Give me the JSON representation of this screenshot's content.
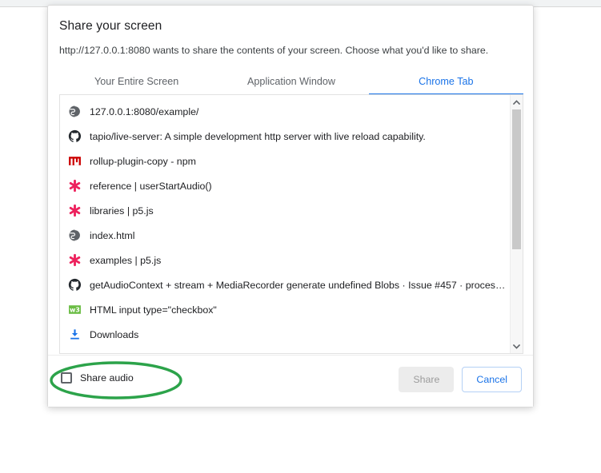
{
  "dialog": {
    "title": "Share your screen",
    "description": "http://127.0.0.1:8080 wants to share the contents of your screen. Choose what you'd like to share.",
    "tabs": [
      {
        "label": "Your Entire Screen",
        "active": false
      },
      {
        "label": "Application Window",
        "active": false
      },
      {
        "label": "Chrome Tab",
        "active": true
      }
    ],
    "list": [
      {
        "icon": "globe-icon",
        "label": "127.0.0.1:8080/example/"
      },
      {
        "icon": "github-icon",
        "label": "tapio/live-server: A simple development http server with live reload capability."
      },
      {
        "icon": "npm-icon",
        "label": "rollup-plugin-copy - npm"
      },
      {
        "icon": "p5js-icon",
        "label": "reference | userStartAudio()"
      },
      {
        "icon": "p5js-icon",
        "label": "libraries | p5.js"
      },
      {
        "icon": "globe-icon",
        "label": "index.html"
      },
      {
        "icon": "p5js-icon",
        "label": "examples | p5.js"
      },
      {
        "icon": "github-icon",
        "label": "getAudioContext + stream + MediaRecorder generate undefined Blobs · Issue #457 · processing..."
      },
      {
        "icon": "w3schools-icon",
        "label": "HTML input type=\"checkbox\""
      },
      {
        "icon": "download-icon",
        "label": "Downloads"
      }
    ],
    "scrollbar": {
      "up_arrow": "▲",
      "down_arrow": "▼"
    },
    "footer": {
      "share_audio_label": "Share audio",
      "share_audio_checked": false,
      "share_button": "Share",
      "share_button_disabled": true,
      "cancel_button": "Cancel"
    }
  },
  "annotation": {
    "shape": "ellipse",
    "color": "#2ca34a",
    "target": "share-audio-checkbox"
  },
  "colors": {
    "accent": "#1a73e8",
    "annotation": "#2ca34a",
    "npm": "#cb0000",
    "p5js": "#ed225d",
    "w3schools": "#6bbd45",
    "download": "#1a73e8"
  }
}
